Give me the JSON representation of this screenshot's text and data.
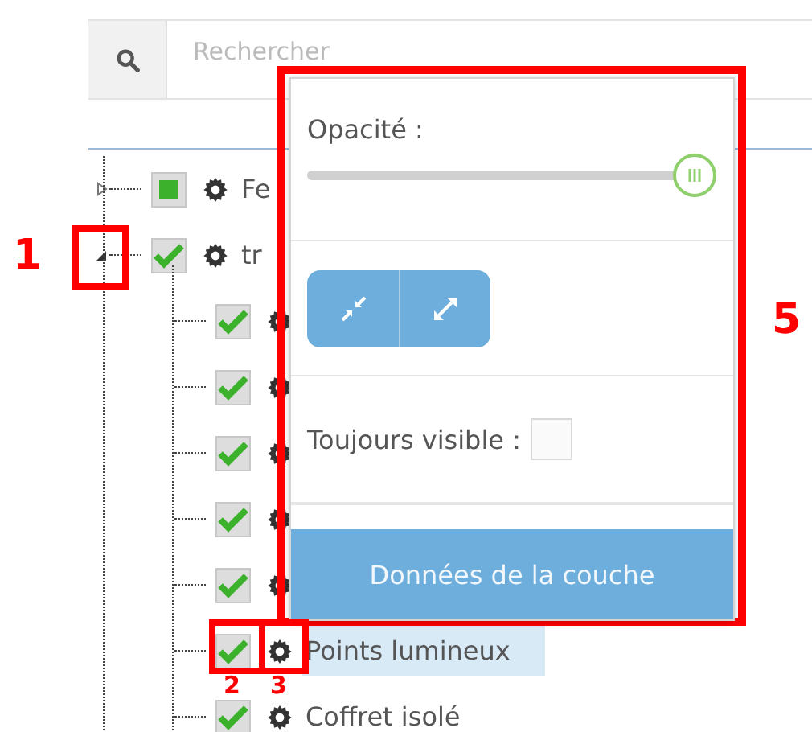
{
  "search": {
    "placeholder": "Rechercher"
  },
  "tree": [
    {
      "label": "Fe",
      "checked": false,
      "indeterminate": true,
      "expanded": false,
      "selected": false
    },
    {
      "label": "tr",
      "checked": true,
      "expanded": true,
      "selected": false,
      "children": [
        {
          "checked": true,
          "selected": false
        },
        {
          "checked": true,
          "selected": false
        },
        {
          "checked": true,
          "selected": false
        },
        {
          "checked": true,
          "selected": false
        },
        {
          "checked": true,
          "selected": false
        },
        {
          "label": "Points lumineux",
          "checked": true,
          "selected": true
        },
        {
          "label": "Coffret isolé",
          "checked": true,
          "selected": false
        }
      ]
    }
  ],
  "popup": {
    "opacity_label": "Opacité :",
    "opacity": {
      "level": 1.0
    },
    "always_visible_label": "Toujours visible :",
    "always_visible": false,
    "data_button": "Données de la couche"
  },
  "annotations": [
    {
      "label": "1"
    },
    {
      "label": "2"
    },
    {
      "label": "3"
    },
    {
      "label": "5"
    }
  ]
}
